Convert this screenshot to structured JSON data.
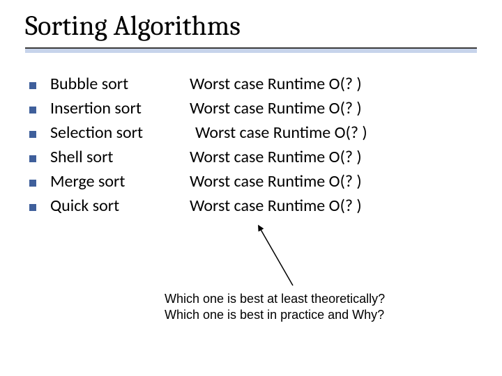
{
  "title": "Sorting Algorithms",
  "items": [
    {
      "name": "Bubble sort",
      "runtime": "Worst case Runtime  O(? )",
      "nudge": false
    },
    {
      "name": "Insertion sort",
      "runtime": "Worst case Runtime  O(? )",
      "nudge": false
    },
    {
      "name": "Selection sort",
      "runtime": "Worst case Runtime  O(? )",
      "nudge": true
    },
    {
      "name": "Shell sort",
      "runtime": "Worst case Runtime  O(? )",
      "nudge": false
    },
    {
      "name": "Merge sort",
      "runtime": "Worst case Runtime  O(? )",
      "nudge": false
    },
    {
      "name": "Quick sort",
      "runtime": "Worst case Runtime  O(? )",
      "nudge": false
    }
  ],
  "question1": "Which one is best at least theoretically?",
  "question2": "Which one is best in practice and Why?",
  "colors": {
    "bullet": "#3f5f9b",
    "underlineLight": "#c7d4eb"
  }
}
